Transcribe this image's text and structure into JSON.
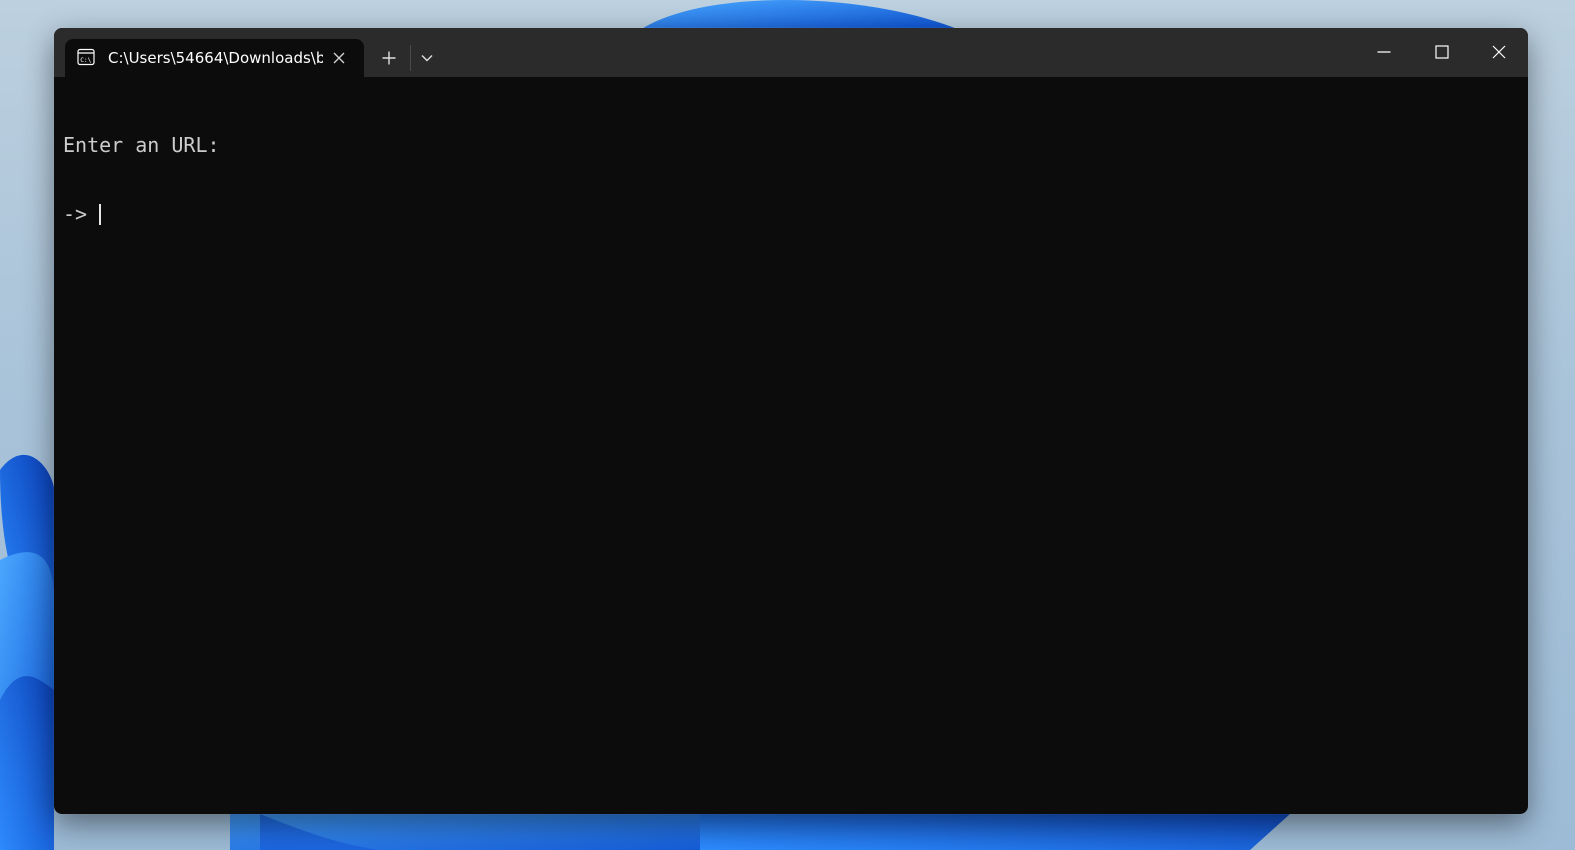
{
  "window": {
    "tab_title": "C:\\Users\\54664\\Downloads\\b"
  },
  "console": {
    "lines": [
      "Enter an URL:"
    ],
    "prompt": "-> ",
    "input_value": ""
  },
  "icons": {
    "tab": "cmd-terminal-icon",
    "close_tab": "close-icon",
    "new_tab": "plus-icon",
    "dropdown": "chevron-down-icon",
    "minimize": "minimize-icon",
    "maximize": "maximize-icon",
    "close_window": "close-icon"
  },
  "colors": {
    "titlebar": "#2b2b2b",
    "console_background": "#0c0c0c",
    "console_text": "#cccccc",
    "wallpaper_accent": "#1f6fe0"
  }
}
